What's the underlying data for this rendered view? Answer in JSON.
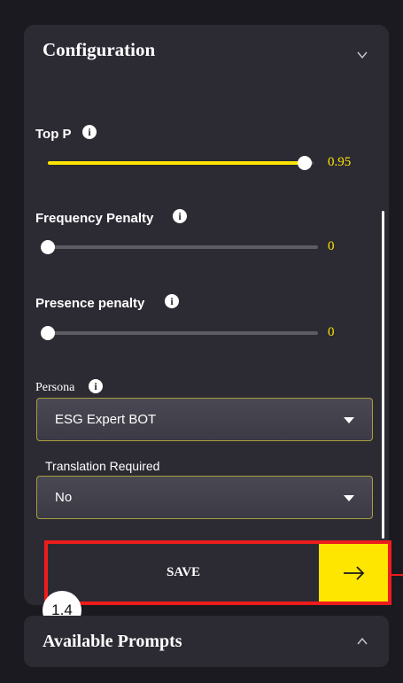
{
  "configuration": {
    "title": "Configuration",
    "top_p": {
      "label": "Top P",
      "value": "0.95",
      "fraction": 0.95
    },
    "frequency_penalty": {
      "label": "Frequency Penalty",
      "value": "0",
      "fraction": 0
    },
    "presence_penalty": {
      "label": "Presence penalty",
      "value": "0",
      "fraction": 0
    },
    "persona": {
      "label": "Persona",
      "selected": "ESG Expert BOT"
    },
    "translation": {
      "label": "Translation Required",
      "selected": "No"
    },
    "save_label": "SAVE",
    "step_badge": "1.4"
  },
  "prompts_panel": {
    "title": "Available Prompts"
  },
  "colors": {
    "accent": "#ffe600",
    "highlight": "#ee1c1c",
    "panel": "#2c2b34"
  },
  "icons": [
    "chevron-down-icon",
    "info-icon",
    "caret-down-icon",
    "arrow-right-icon",
    "chevron-up-icon"
  ]
}
